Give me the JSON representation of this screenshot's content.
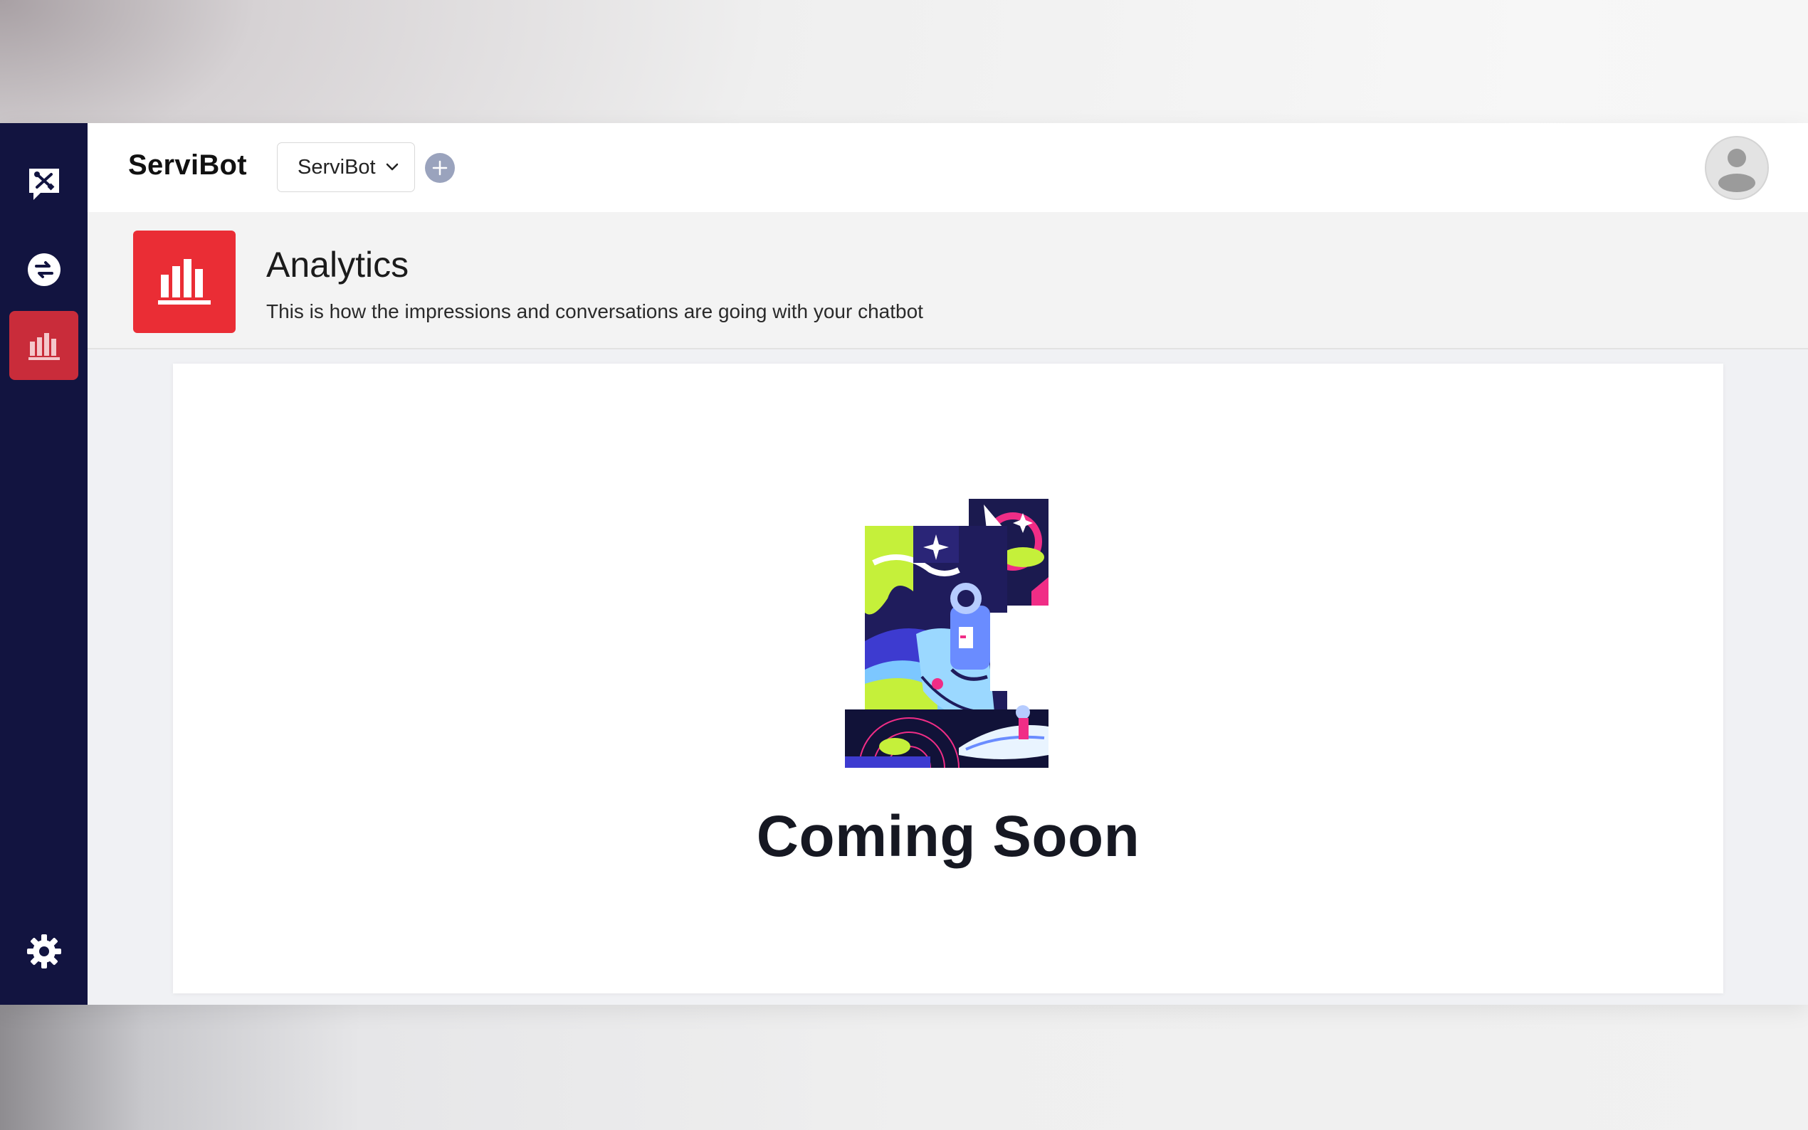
{
  "brand": {
    "name": "ServiBot"
  },
  "bot_selector": {
    "selected": "ServiBot"
  },
  "sidebar": {
    "items": [
      {
        "icon": "chat-tools-icon",
        "active": false
      },
      {
        "icon": "integrations-icon",
        "active": false
      },
      {
        "icon": "analytics-icon",
        "active": true
      }
    ],
    "settings_icon": "gear-icon"
  },
  "header": {
    "title": "Analytics",
    "subtitle": "This is how the impressions and conversations are going with your chatbot"
  },
  "content": {
    "message": "Coming Soon"
  },
  "colors": {
    "sidebar_bg": "#121440",
    "active_item": "#c92c3a",
    "header_icon_bg": "#ea2d35"
  }
}
